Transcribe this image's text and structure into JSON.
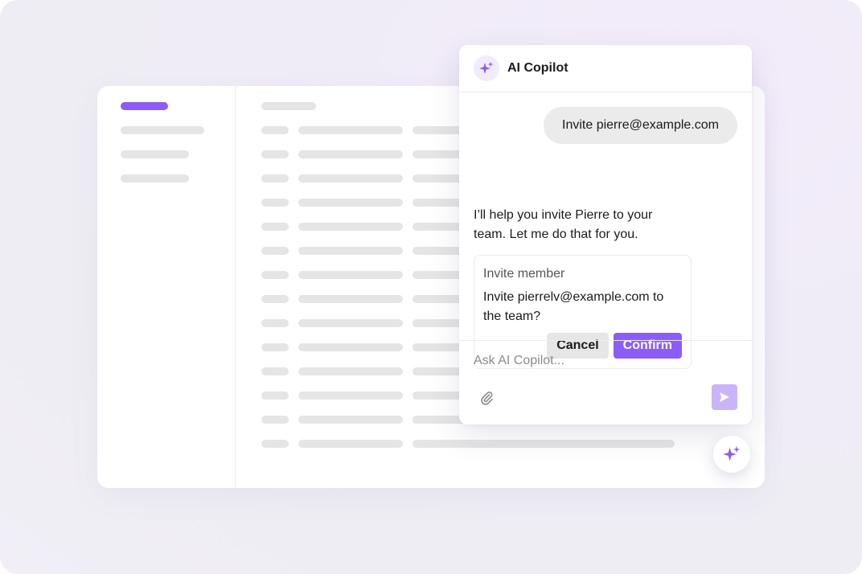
{
  "copilot": {
    "title": "AI Copilot",
    "user_message": "Invite pierre@example.com",
    "assistant_message": "I’ll help you invite Pierre to your team. Let me do that for you.",
    "invite_card": {
      "title": "Invite member",
      "text": "Invite pierrelv@example.com to the team?",
      "cancel_label": "Cancel",
      "confirm_label": "Confirm"
    },
    "input": {
      "value": "",
      "placeholder": "Ask AI Copilot..."
    }
  },
  "icons": {
    "copilot_logo": "sparkle-icon",
    "attach": "paperclip-icon",
    "send": "send-arrow-icon",
    "fab": "sparkle-icon"
  },
  "colors": {
    "accent": "#8b5cf6",
    "send_disabled": "#c9b4f9",
    "skeleton": "#e5e5e5"
  }
}
